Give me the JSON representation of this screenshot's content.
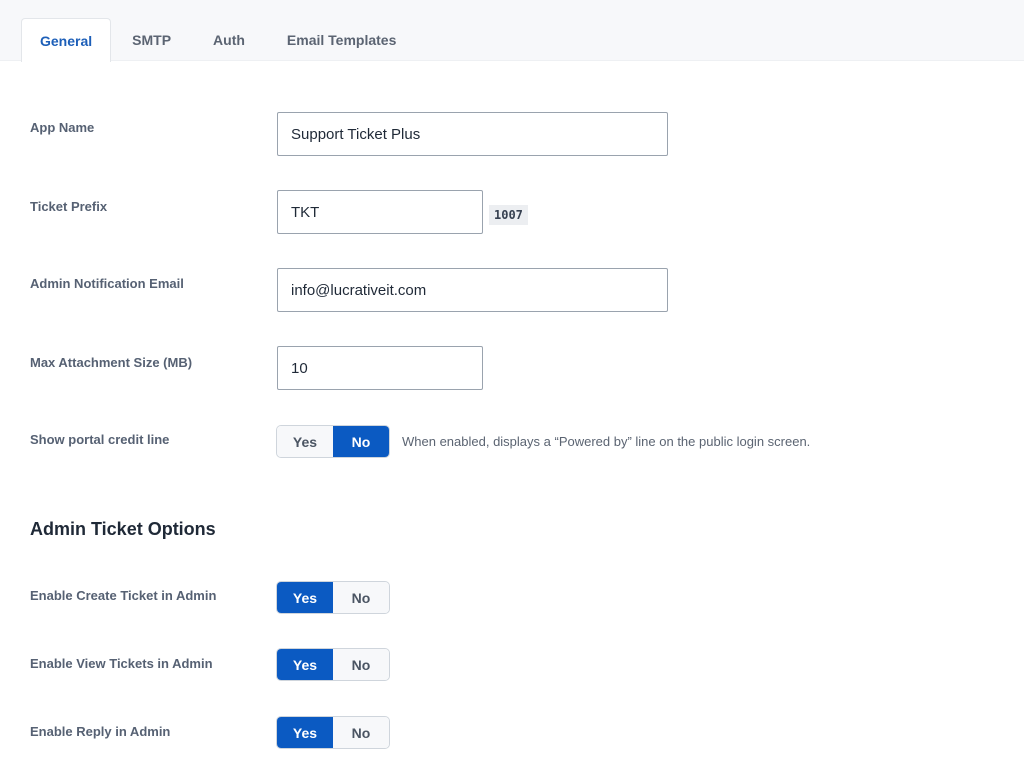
{
  "tabs": [
    {
      "label": "General",
      "active": true
    },
    {
      "label": "SMTP",
      "active": false
    },
    {
      "label": "Auth",
      "active": false
    },
    {
      "label": "Email Templates",
      "active": false
    }
  ],
  "general": {
    "app_name": {
      "label": "App Name",
      "value": "Support Ticket Plus"
    },
    "ticket_prefix": {
      "label": "Ticket Prefix",
      "value": "TKT",
      "preview": "1007"
    },
    "admin_email": {
      "label": "Admin Notification Email",
      "value": "info@lucrativeit.com"
    },
    "max_attachment": {
      "label": "Max Attachment Size (MB)",
      "value": "10"
    },
    "credit_line": {
      "label": "Show portal credit line",
      "yes": "Yes",
      "no": "No",
      "selected": "No",
      "hint": "When enabled, displays a “Powered by” line on the public login screen."
    }
  },
  "admin_options": {
    "title": "Admin Ticket Options",
    "create_ticket": {
      "label": "Enable Create Ticket in Admin",
      "yes": "Yes",
      "no": "No",
      "selected": "Yes"
    },
    "view_tickets": {
      "label": "Enable View Tickets in Admin",
      "yes": "Yes",
      "no": "No",
      "selected": "Yes"
    },
    "reply": {
      "label": "Enable Reply in Admin",
      "yes": "Yes",
      "no": "No",
      "selected": "Yes"
    }
  },
  "colors": {
    "accent": "#0b5ac2",
    "active_tab_text": "#1d5fb8"
  }
}
